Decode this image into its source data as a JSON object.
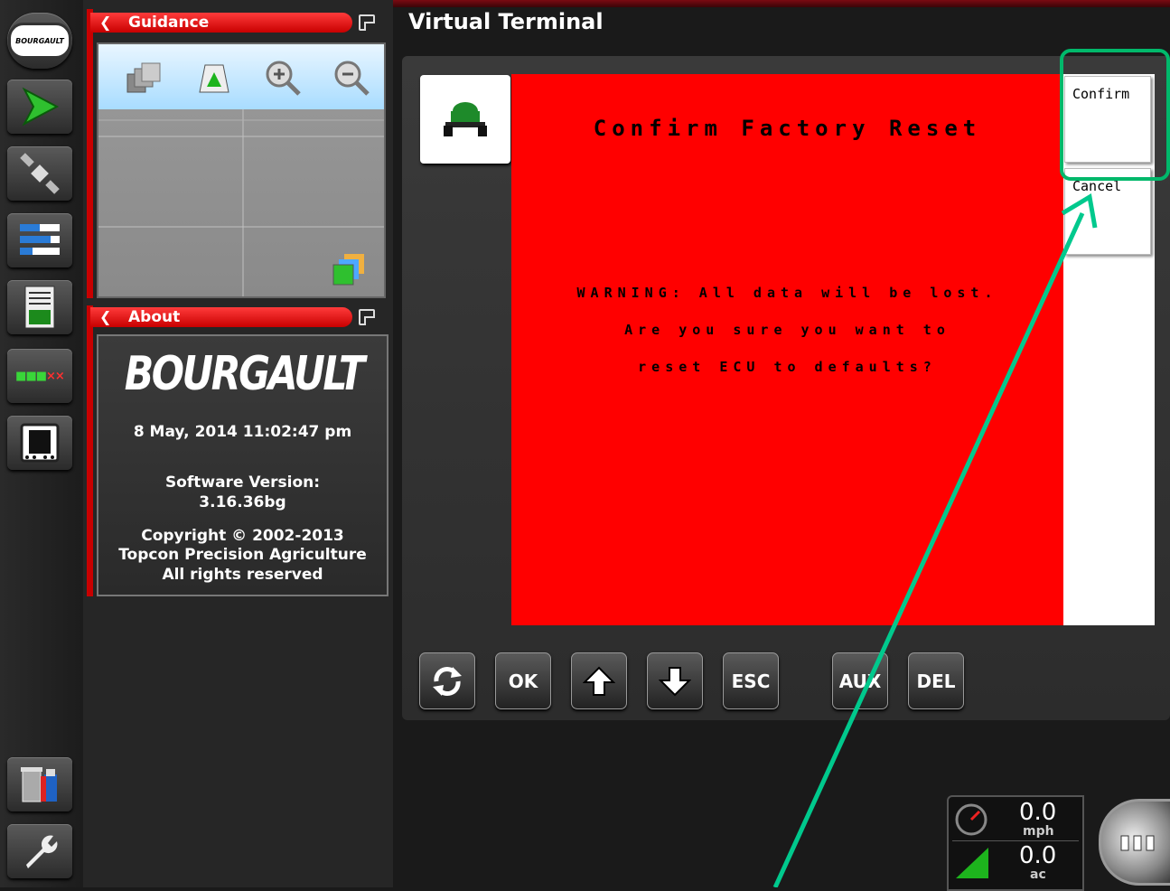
{
  "guidance": {
    "title": "Guidance"
  },
  "about": {
    "title": "About",
    "logo": "BOURGAULT",
    "datetime": "8 May, 2014  11:02:47 pm",
    "software_label": "Software Version:",
    "software_version": "3.16.36bg",
    "copyright": "Copyright © 2002-2013",
    "company": "Topcon Precision Agriculture",
    "rights": "All rights reserved"
  },
  "left_toolbar": {
    "brand": "BOURGAULT"
  },
  "vt": {
    "title": "Virtual Terminal",
    "heading": "Confirm Factory Reset",
    "warning_lines": [
      "WARNING: All data will be lost.",
      "Are you sure you want to",
      "reset ECU to defaults?"
    ],
    "softkeys": [
      "Confirm",
      "Cancel"
    ],
    "buttons": {
      "ok": "OK",
      "esc": "ESC",
      "aux": "AUX",
      "del": "DEL"
    }
  },
  "gauges": {
    "speed": "0.0",
    "speed_unit": "mph",
    "area": "0.0",
    "area_unit": "ac"
  },
  "colors": {
    "vt_background": "#ff0000",
    "header_red": "#e00000",
    "annotation": "#00c98d"
  }
}
